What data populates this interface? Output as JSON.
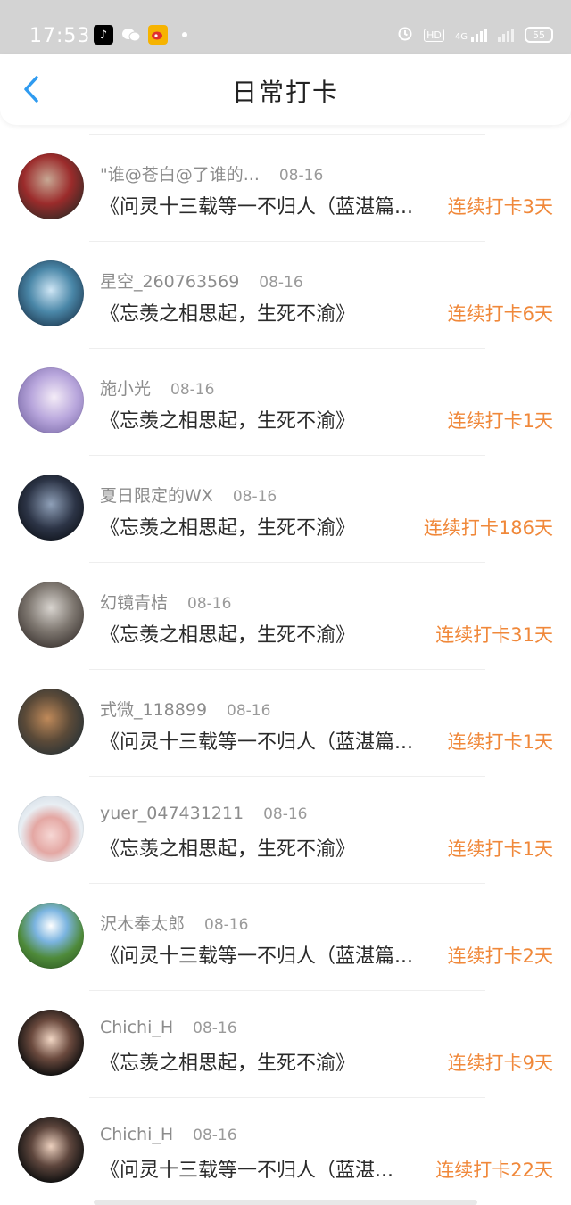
{
  "status_bar": {
    "time": "17:53",
    "hd": "HD",
    "net": "4G",
    "battery": "55"
  },
  "header": {
    "title": "日常打卡"
  },
  "colors": {
    "accent": "#f0883a",
    "back": "#2f9bf0"
  },
  "checkins": [
    {
      "name": "\"谁@苍白@了谁的...",
      "date": "08-16",
      "content": "《问灵十三载等一不归人（蓝湛篇...",
      "streak": "连续打卡3天"
    },
    {
      "name": "星空_260763569",
      "date": "08-16",
      "content": "《忘羡之相思起，生死不渝》",
      "streak": "连续打卡6天"
    },
    {
      "name": "施小光",
      "date": "08-16",
      "content": "《忘羡之相思起，生死不渝》",
      "streak": "连续打卡1天"
    },
    {
      "name": "夏日限定的WX",
      "date": "08-16",
      "content": "《忘羡之相思起，生死不渝》",
      "streak": "连续打卡186天"
    },
    {
      "name": "幻镜青桔",
      "date": "08-16",
      "content": "《忘羡之相思起，生死不渝》",
      "streak": "连续打卡31天"
    },
    {
      "name": "式微_118899",
      "date": "08-16",
      "content": "《问灵十三载等一不归人（蓝湛篇...",
      "streak": "连续打卡1天"
    },
    {
      "name": "yuer_047431211",
      "date": "08-16",
      "content": "《忘羡之相思起，生死不渝》",
      "streak": "连续打卡1天"
    },
    {
      "name": "沢木奉太郎",
      "date": "08-16",
      "content": "《问灵十三载等一不归人（蓝湛篇...",
      "streak": "连续打卡2天"
    },
    {
      "name": "Chichi_H",
      "date": "08-16",
      "content": "《忘羡之相思起，生死不渝》",
      "streak": "连续打卡9天"
    },
    {
      "name": "Chichi_H",
      "date": "08-16",
      "content": "《问灵十三载等一不归人（蓝湛...",
      "streak": "连续打卡22天"
    }
  ]
}
